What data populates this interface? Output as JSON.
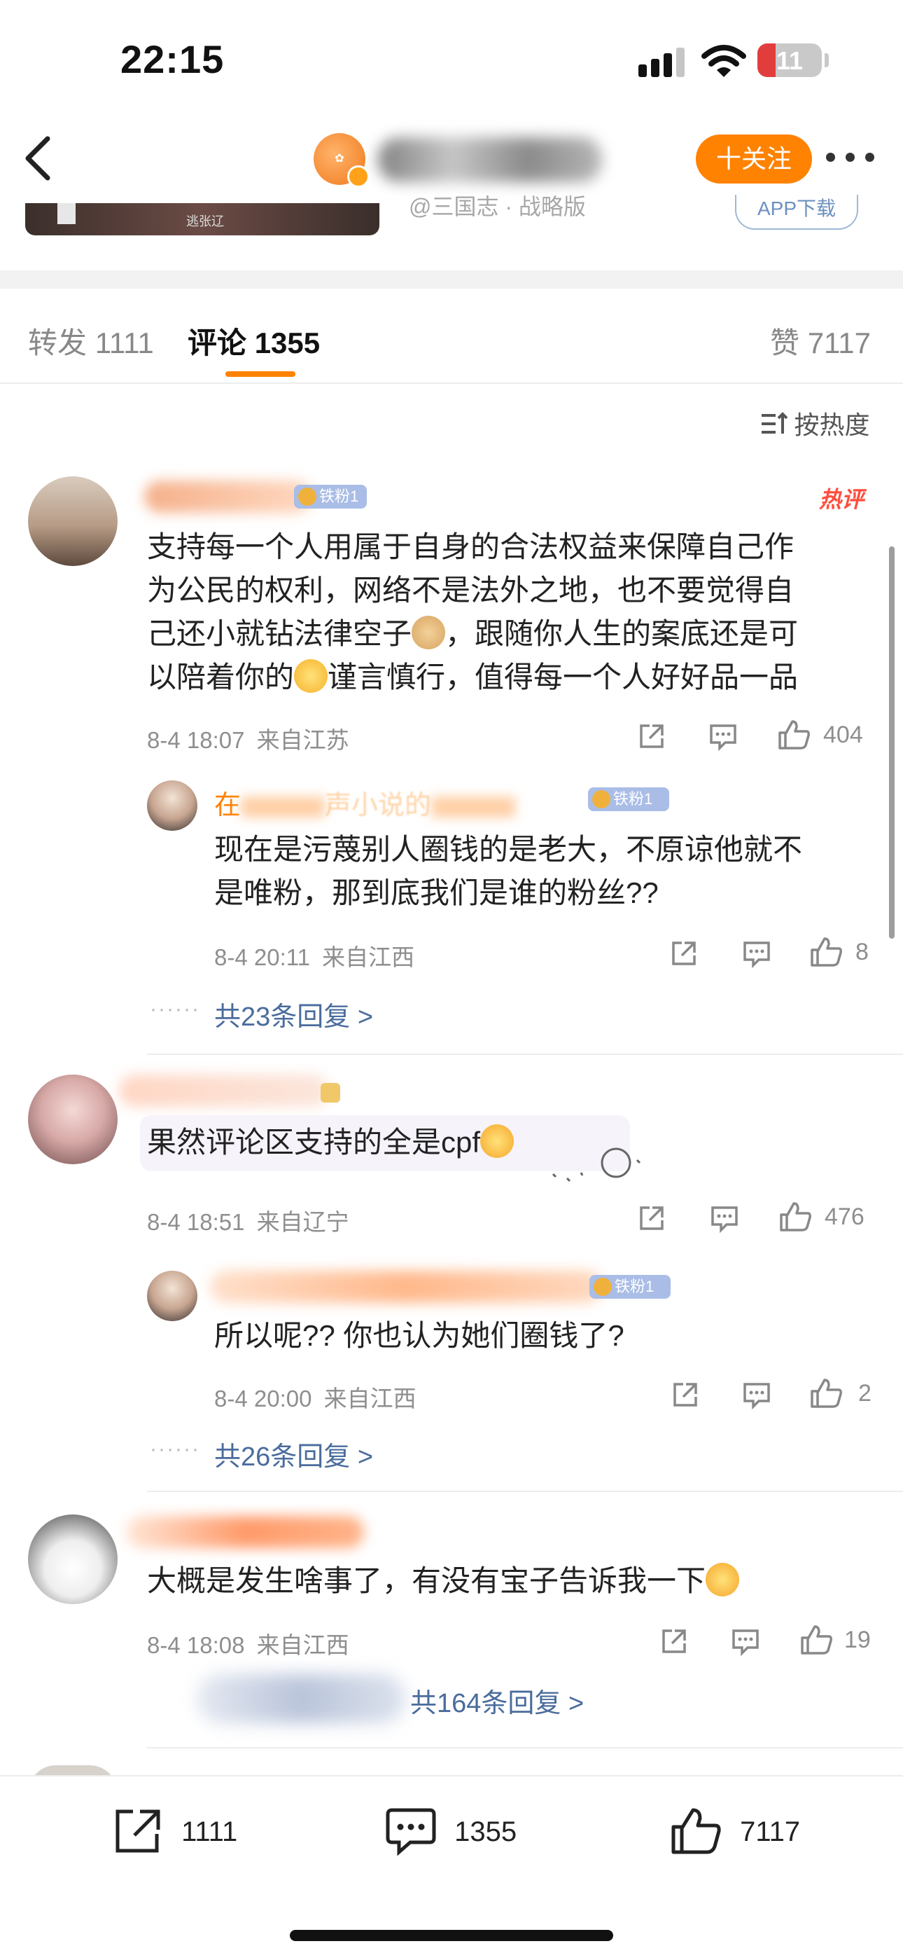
{
  "status_bar": {
    "time": "22:15",
    "battery": "11",
    "battery_level": 0.11
  },
  "nav": {
    "follow_label": "十关注"
  },
  "card": {
    "image_label": "逃张辽",
    "subtitle": "@三国志 · 战略版",
    "app_button": "APP下载"
  },
  "tabs": [
    {
      "label": "转发",
      "count": "1111"
    },
    {
      "label": "评论",
      "count": "1355"
    },
    {
      "label": "赞",
      "count": "7117"
    }
  ],
  "sort_label": "按热度",
  "comments": [
    {
      "name_initial": "",
      "badge": "铁粉1",
      "hot_tag": "热评",
      "lines": [
        "支持每一个人用属于自身的合法权益来保障自己作",
        "为公民的权利，网络不是法外之地，也不要觉得自",
        "己还小就钻法律空子",
        "，跟随你人生的案底还是可",
        "以陪着你的",
        "谨言慎行，值得每一个人好好品一品"
      ],
      "time": "8-4 18:07",
      "location": "来自江苏",
      "likes": "404",
      "reply": {
        "name_visible": "在",
        "name_mid": "声小说的",
        "badge": "铁粉1",
        "lines": [
          "现在是污蔑别人圈钱的是老大，不原谅他就不",
          "是唯粉，那到底我们是谁的粉丝??"
        ],
        "time": "8-4 20:11",
        "location": "来自江西",
        "likes": "8"
      },
      "more_replies": "共23条回复 >"
    },
    {
      "badge": "",
      "lines": [
        "果然评论区支持的全是cpf"
      ],
      "time": "8-4 18:51",
      "location": "来自辽宁",
      "likes": "476",
      "reply": {
        "badge": "铁粉1",
        "lines": [
          "所以呢?? 你也认为她们圈钱了?"
        ],
        "time": "8-4 20:00",
        "location": "来自江西",
        "likes": "2"
      },
      "more_replies": "共26条回复 >"
    },
    {
      "lines": [
        "大概是发生啥事了，有没有宝子告诉我一下"
      ],
      "time": "8-4 18:08",
      "location": "来自江西",
      "likes": "19",
      "more_replies": "共164条回复 >"
    }
  ],
  "bottom_bar": {
    "reposts": "1111",
    "comments": "1355",
    "likes": "7117"
  }
}
